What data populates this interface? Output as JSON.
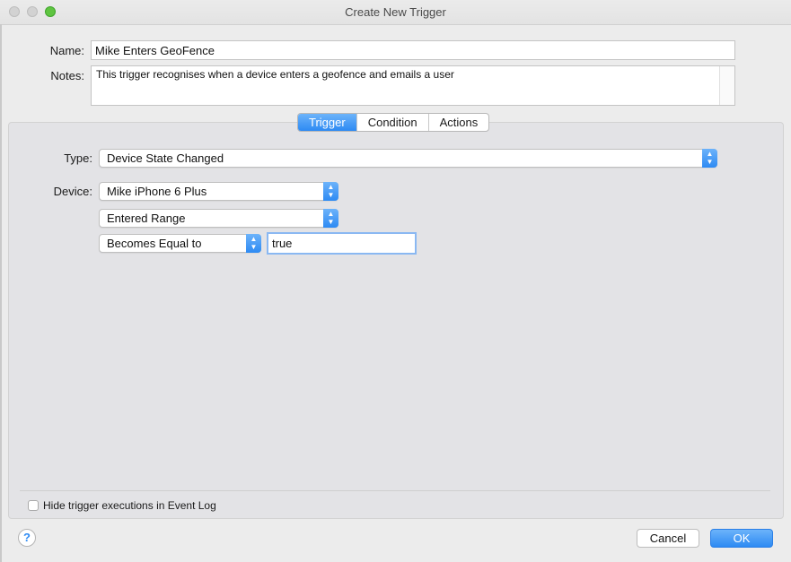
{
  "window": {
    "title": "Create New Trigger"
  },
  "form": {
    "name_label": "Name:",
    "name_value": "Mike Enters GeoFence",
    "notes_label": "Notes:",
    "notes_value": "This trigger recognises when a device enters a geofence and emails a user"
  },
  "tabs": [
    "Trigger",
    "Condition",
    "Actions"
  ],
  "active_tab": "Trigger",
  "trigger": {
    "type_label": "Type:",
    "type_value": "Device State Changed",
    "device_label": "Device:",
    "device_value": "Mike iPhone 6 Plus",
    "state_value": "Entered Range",
    "comparison_value": "Becomes Equal to",
    "value_field": "true"
  },
  "footer": {
    "hide_checkbox_label": "Hide trigger executions in Event Log",
    "hide_checked": false,
    "help_label": "?",
    "cancel_label": "Cancel",
    "ok_label": "OK"
  },
  "colors": {
    "accent": "#2d8af3",
    "panel": "#e3e3e6",
    "window": "#ececec"
  },
  "icons": {
    "stepper": "updown-chevron-icon",
    "help": "help-icon"
  }
}
